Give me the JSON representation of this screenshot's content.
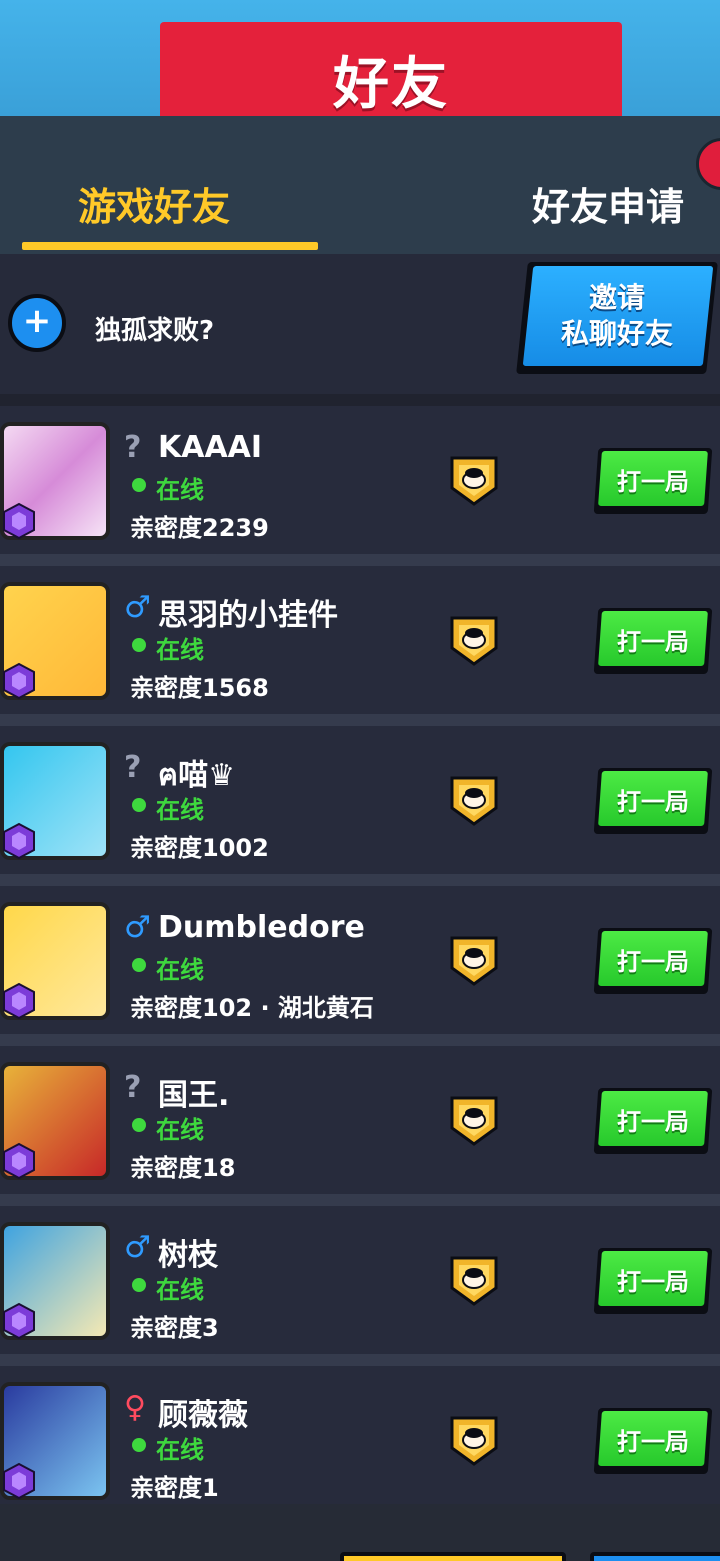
{
  "header": {
    "title": "好友"
  },
  "tabs": [
    {
      "label": "游戏好友",
      "active": true
    },
    {
      "label": "好友申请",
      "active": false
    }
  ],
  "invite": {
    "prompt": "独孤求败?",
    "button_line1": "邀请",
    "button_line2": "私聊好友"
  },
  "colors": {
    "accent_yellow": "#ffc928",
    "banner_red": "#e4213b",
    "online_green": "#3ed93e",
    "play_green": "#27c92c",
    "invite_blue": "#168ce6"
  },
  "friends": [
    {
      "gender": "?",
      "gender_type": "unknown",
      "name": "KAAAI",
      "status": "在线",
      "intimacy": "亲密度2239",
      "play_label": "打一局"
    },
    {
      "gender": "♂",
      "gender_type": "male",
      "name": "思羽的小挂件",
      "status": "在线",
      "intimacy": "亲密度1568",
      "play_label": "打一局"
    },
    {
      "gender": "?",
      "gender_type": "unknown",
      "name": "ฅ喵♛",
      "status": "在线",
      "intimacy": "亲密度1002",
      "play_label": "打一局"
    },
    {
      "gender": "♂",
      "gender_type": "male",
      "name": "Dumbledore",
      "status": "在线",
      "intimacy": "亲密度102 · 湖北黄石",
      "play_label": "打一局"
    },
    {
      "gender": "?",
      "gender_type": "unknown",
      "name": "国王.",
      "status": "在线",
      "intimacy": "亲密度18",
      "play_label": "打一局"
    },
    {
      "gender": "♂",
      "gender_type": "male",
      "name": "树枝",
      "status": "在线",
      "intimacy": "亲密度3",
      "play_label": "打一局"
    },
    {
      "gender": "♀",
      "gender_type": "female",
      "name": "顾薇薇",
      "status": "在线",
      "intimacy": "亲密度1",
      "play_label": "打一局"
    }
  ]
}
